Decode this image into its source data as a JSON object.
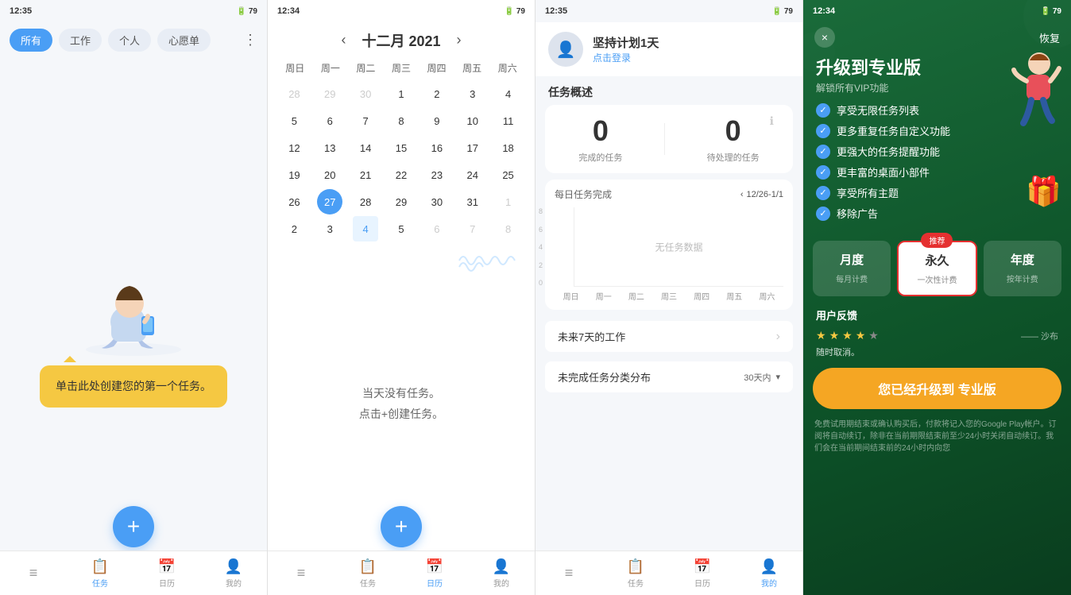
{
  "panel1": {
    "status": {
      "time": "12:35",
      "signal": "📶",
      "battery": "79"
    },
    "filters": [
      "所有",
      "工作",
      "个人",
      "心愿单"
    ],
    "active_filter": "所有",
    "speech_bubble": "单击此处创建您的第一个任务。",
    "fab_icon": "+",
    "nav": [
      {
        "icon": "≡",
        "label": "任务",
        "active": false
      },
      {
        "icon": "📅",
        "label": "日历",
        "active": false
      },
      {
        "icon": "👤",
        "label": "我的",
        "active": false
      }
    ]
  },
  "panel2": {
    "status": {
      "time": "12:34",
      "signal": "📶",
      "battery": "79"
    },
    "calendar": {
      "month": "十二月",
      "year": "2021",
      "weekdays": [
        "周日",
        "周一",
        "周二",
        "周三",
        "周四",
        "周五",
        "周六"
      ],
      "weeks": [
        [
          "28",
          "29",
          "30",
          "1",
          "2",
          "3",
          "4"
        ],
        [
          "5",
          "6",
          "7",
          "8",
          "9",
          "10",
          "11"
        ],
        [
          "12",
          "13",
          "14",
          "15",
          "16",
          "17",
          "18"
        ],
        [
          "19",
          "20",
          "21",
          "22",
          "23",
          "24",
          "25"
        ],
        [
          "26",
          "27",
          "28",
          "29",
          "30",
          "31",
          "1"
        ],
        [
          "2",
          "3",
          "4",
          "5",
          "6",
          "7",
          "8"
        ]
      ],
      "other_month_cells": [
        "28",
        "29",
        "30",
        "1",
        "8"
      ],
      "today_cell": "27",
      "selected_cells": [
        "4"
      ]
    },
    "empty_state_line1": "当天没有任务。",
    "empty_state_line2": "点击+创建任务。",
    "fab_icon": "+",
    "nav": [
      {
        "icon": "≡",
        "label": "任务",
        "active": false
      },
      {
        "icon": "📋",
        "label": "任务",
        "active": false
      },
      {
        "icon": "📅",
        "label": "日历",
        "active": true
      },
      {
        "icon": "👤",
        "label": "我的",
        "active": false
      }
    ]
  },
  "panel3": {
    "status": {
      "time": "12:35",
      "signal": "📶",
      "battery": "79"
    },
    "user": {
      "name": "坚持计划1天",
      "login_text": "点击登录"
    },
    "overview_title": "任务概述",
    "completed_count": "0",
    "completed_label": "完成的任务",
    "pending_count": "0",
    "pending_label": "待处理的任务",
    "chart_title": "每日任务完成",
    "chart_period": "12/26-1/1",
    "chart_no_data": "无任务数据",
    "chart_y_labels": [
      "8",
      "6",
      "4",
      "2",
      "0"
    ],
    "chart_x_labels": [
      "周日",
      "周一",
      "周二",
      "周三",
      "周四",
      "周五",
      "周六"
    ],
    "future_work_label": "未来7天的工作",
    "distribution_label": "未完成任务分类分布",
    "distribution_period": "30天内",
    "nav": [
      {
        "icon": "≡",
        "label": "任务",
        "active": false
      },
      {
        "icon": "📋",
        "label": "任务",
        "active": false
      },
      {
        "icon": "📅",
        "label": "日历",
        "active": false
      },
      {
        "icon": "👤",
        "label": "我的",
        "active": true
      }
    ]
  },
  "panel4": {
    "status": {
      "time": "12:34",
      "signal": "📶",
      "battery": "79"
    },
    "close_icon": "×",
    "restore_label": "恢复",
    "title": "升级到专业版",
    "subtitle": "解锁所有VIP功能",
    "features": [
      "享受无限任务列表",
      "更多重复任务自定义功能",
      "更强大的任务提醒功能",
      "更丰富的桌面小部件",
      "享受所有主题",
      "移除广告"
    ],
    "plans": [
      {
        "name": "月度",
        "billing": "每月计费",
        "recommended": false
      },
      {
        "name": "永久",
        "billing": "一次性计费",
        "recommended": true
      },
      {
        "name": "年度",
        "billing": "按年计费",
        "recommended": false
      }
    ],
    "recommended_label": "推荐",
    "feedback_title": "用户反馈",
    "stars": 4,
    "reviewer": "沙布",
    "feedback_text": "随时取消。",
    "upgrade_btn_text": "您已经升级到  专业版",
    "disclaimer": "免费试用期结束或确认购买后，付款将记入您的Google Play帐户。订阅将自动续订，除非在当前期限结束前至少24小时关闭自动续订。我们会在当前期间结束前的24小时内向您"
  }
}
